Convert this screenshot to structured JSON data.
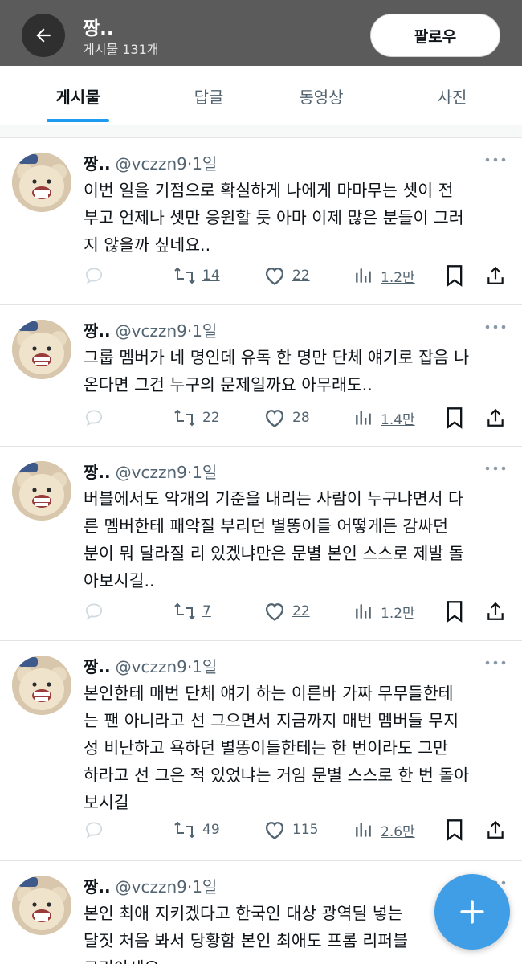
{
  "header": {
    "name": "짱..",
    "post_count": "게시물 131개",
    "follow_label": "팔로우"
  },
  "tabs": [
    {
      "label": "게시물",
      "active": true
    },
    {
      "label": "답글",
      "active": false
    },
    {
      "label": "동영상",
      "active": false
    },
    {
      "label": "사진",
      "active": false
    }
  ],
  "posts": [
    {
      "name": "짱..",
      "handle": "@vczzn9",
      "sep": "·",
      "time": "1일",
      "lines": [
        "이번 일을 기점으로 확실하게 나에게 마마무는 셋이 전",
        "부고 언제나 셋만 응원할 듯 아마 이제 많은 분들이 그러",
        "지 않을까 싶네요.."
      ],
      "retweets": "14",
      "likes": "22",
      "views": "1.2만"
    },
    {
      "name": "짱..",
      "handle": "@vczzn9",
      "sep": "·",
      "time": "1일",
      "lines": [
        "그룹 멤버가 네 명인데 유독 한 명만 단체 얘기로 잡음 나",
        "온다면 그건 누구의 문제일까요 아무래도.."
      ],
      "retweets": "22",
      "likes": "28",
      "views": "1.4만"
    },
    {
      "name": "짱..",
      "handle": "@vczzn9",
      "sep": "·",
      "time": "1일",
      "lines": [
        "버블에서도 악개의 기준을 내리는 사람이 누구냐면서 다",
        "른 멤버한테 패악질 부리던 별똥이들 어떻게든 감싸던",
        "분이 뭐 달라질 리 있겠냐만은 문별 본인 스스로 제발 돌",
        "아보시길.."
      ],
      "retweets": "7",
      "likes": "22",
      "views": "1.2만"
    },
    {
      "name": "짱..",
      "handle": "@vczzn9",
      "sep": "·",
      "time": "1일",
      "lines": [
        "본인한테 매번 단체 얘기 하는 이른바 가짜 무무들한테",
        "는 팬 아니라고 선 그으면서 지금까지 매번 멤버들 무지",
        "성 비난하고 욕하던 별똥이들한테는 한 번이라도 그만",
        "하라고 선 그은 적 있었냐는 거임 문별 스스로 한 번 돌아",
        "보시길"
      ],
      "retweets": "49",
      "likes": "115",
      "views": "2.6만"
    },
    {
      "name": "짱..",
      "handle": "@vczzn9",
      "sep": "·",
      "time": "1일",
      "lines": [
        "본인 최애 지키겠다고 한국인 대상 광역딜 넣는",
        "달짓 처음 봐서 당황함 본인 최애도 프롬 리퍼블",
        "코리아세요"
      ],
      "retweets": "",
      "likes": "",
      "views": ""
    }
  ],
  "colors": {
    "accent": "#1d9bf0",
    "fab": "#3f9ee6",
    "header_bg": "#5b5b5b",
    "muted": "#536471"
  },
  "icons": [
    "back-arrow-icon",
    "more-icon",
    "reply-icon",
    "retweet-icon",
    "heart-icon",
    "views-icon",
    "bookmark-icon",
    "share-icon",
    "plus-icon"
  ]
}
